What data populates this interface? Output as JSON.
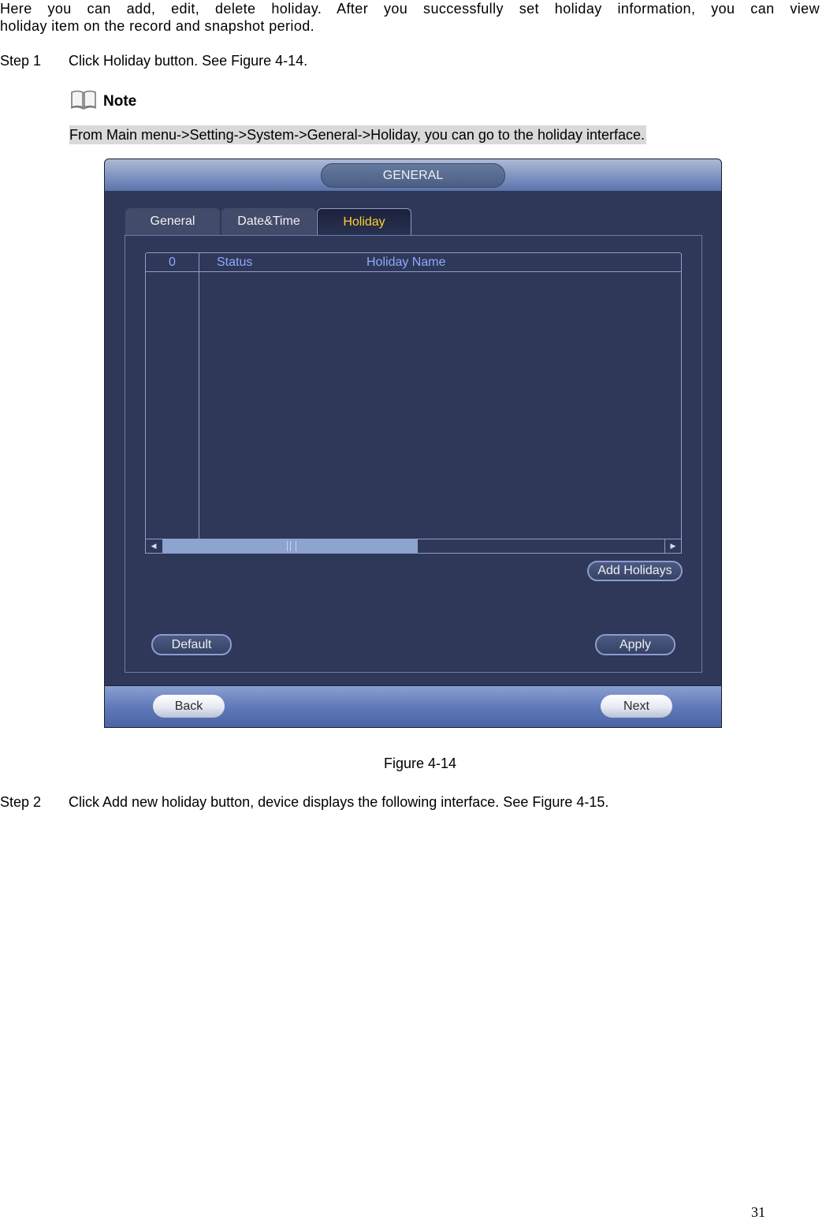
{
  "doc": {
    "intro_line1": "Here you can add, edit, delete holiday. After you successfully set holiday information, you can view",
    "intro_line2": "holiday item on the record and snapshot period.",
    "step1": {
      "label": "Step 1",
      "text": "Click Holiday button. See Figure 4-14."
    },
    "note": {
      "icon": "book-icon",
      "heading": "Note",
      "text": "From Main menu->Setting->System->General->Holiday, you can go to the holiday interface."
    },
    "caption": "Figure 4-14",
    "step2": {
      "label": "Step 2",
      "text": "Click Add new holiday button, device displays the following interface. See Figure 4-15."
    },
    "page_number": "31"
  },
  "dvr": {
    "title": "GENERAL",
    "tabs": [
      {
        "label": "General",
        "active": false
      },
      {
        "label": "Date&Time",
        "active": false
      },
      {
        "label": "Holiday",
        "active": true
      }
    ],
    "table": {
      "headers": {
        "count": "0",
        "status": "Status",
        "name": "Holiday Name"
      },
      "rows": []
    },
    "scrollbar": {
      "left_icon": "arrow-left-icon",
      "right_icon": "arrow-right-icon",
      "left_glyph": "◀",
      "right_glyph": "▶"
    },
    "buttons": {
      "add": "Add Holidays",
      "default": "Default",
      "apply": "Apply",
      "back": "Back",
      "next": "Next"
    },
    "colors": {
      "background": "#2f3858",
      "active_tab_text": "#ffd02e",
      "header_text": "#8fa8ff"
    }
  }
}
